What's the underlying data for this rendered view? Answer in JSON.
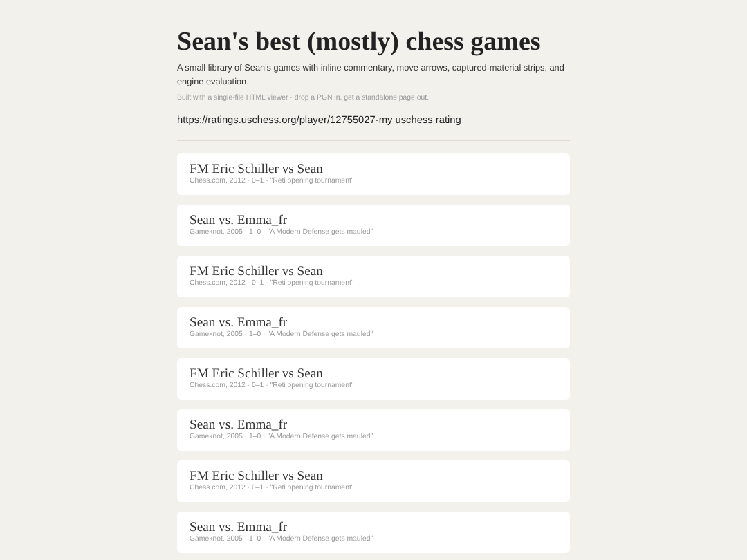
{
  "header": {
    "title": "Sean's best (mostly) chess games",
    "description": "A small library of Sean's games with inline commentary, move arrows, captured-material strips, and engine evaluation.",
    "note": "Built with a single-file HTML viewer · drop a PGN in, get a standalone page out.",
    "link": "https://ratings.uschess.org/player/12755027-my uschess rating"
  },
  "games": [
    {
      "title": "FM Eric Schiller vs Sean",
      "meta": "Chess.com, 2012 · 0–1 · \"Reti opening tournament\""
    },
    {
      "title": "Sean vs. Emma_fr",
      "meta": "Gameknot, 2005 · 1–0 · \"A Modern Defense gets mauled\""
    },
    {
      "title": "FM Eric Schiller vs Sean",
      "meta": "Chess.com, 2012 · 0–1 · \"Reti opening tournament\""
    },
    {
      "title": "Sean vs. Emma_fr",
      "meta": "Gameknot, 2005 · 1–0 · \"A Modern Defense gets mauled\""
    },
    {
      "title": "FM Eric Schiller vs Sean",
      "meta": "Chess.com, 2012 · 0–1 · \"Reti opening tournament\""
    },
    {
      "title": "Sean vs. Emma_fr",
      "meta": "Gameknot, 2005 · 1–0 · \"A Modern Defense gets mauled\""
    },
    {
      "title": "FM Eric Schiller vs Sean",
      "meta": "Chess.com, 2012 · 0–1 · \"Reti opening tournament\""
    },
    {
      "title": "Sean vs. Emma_fr",
      "meta": "Gameknot, 2005 · 1–0 · \"A Modern Defense gets mauled\""
    }
  ]
}
